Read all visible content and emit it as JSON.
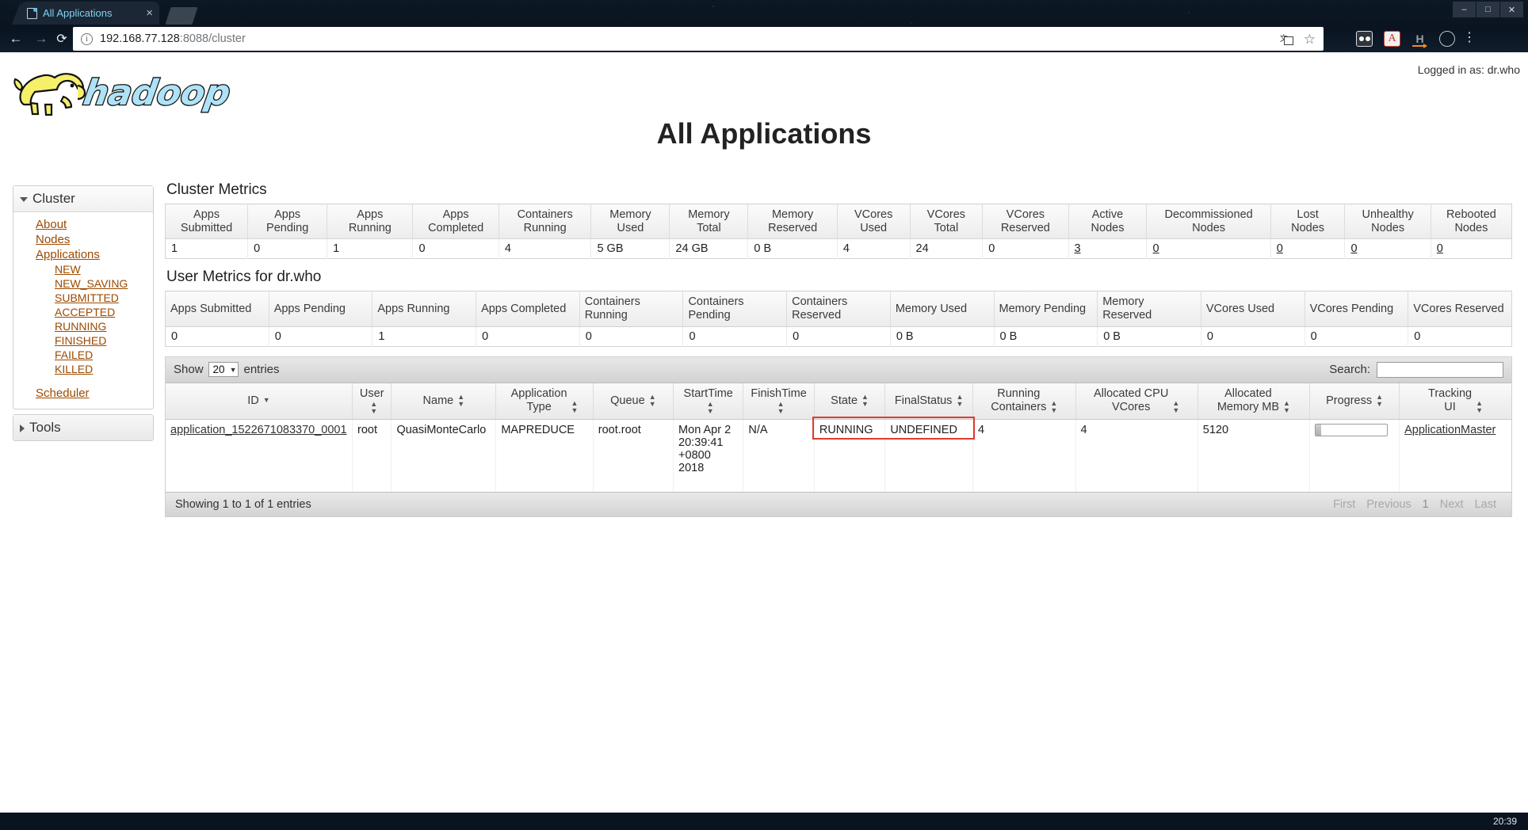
{
  "browser": {
    "tab": {
      "title": "All Applications",
      "favicon": "page-icon",
      "close": "×"
    },
    "nav": {
      "back": "←",
      "forward": "→",
      "reload": "⟳"
    },
    "omnibox": {
      "info_icon": "i",
      "url_host": "192.168.77.128",
      "url_rest": ":8088/cluster",
      "translate_icon": "translate-icon",
      "star_icon": "☆"
    },
    "window_controls": {
      "minimize": "–",
      "maximize": "□",
      "close": "✕",
      "restore": "❐"
    },
    "clock": "20:39"
  },
  "header": {
    "logo_text": "hadoop",
    "logged_in": "Logged in as: dr.who",
    "title": "All Applications"
  },
  "sidebar": {
    "cluster": {
      "label": "Cluster",
      "links": [
        {
          "label": "About"
        },
        {
          "label": "Nodes"
        },
        {
          "label": "Applications"
        }
      ],
      "app_states": [
        {
          "label": "NEW"
        },
        {
          "label": "NEW_SAVING"
        },
        {
          "label": "SUBMITTED"
        },
        {
          "label": "ACCEPTED"
        },
        {
          "label": "RUNNING"
        },
        {
          "label": "FINISHED"
        },
        {
          "label": "FAILED"
        },
        {
          "label": "KILLED"
        }
      ],
      "scheduler": {
        "label": "Scheduler"
      }
    },
    "tools": {
      "label": "Tools"
    }
  },
  "cluster_metrics": {
    "title": "Cluster Metrics",
    "columns": [
      "Apps Submitted",
      "Apps Pending",
      "Apps Running",
      "Apps Completed",
      "Containers Running",
      "Memory Used",
      "Memory Total",
      "Memory Reserved",
      "VCores Used",
      "VCores Total",
      "VCores Reserved",
      "Active Nodes",
      "Decommissioned Nodes",
      "Lost Nodes",
      "Unhealthy Nodes",
      "Rebooted Nodes"
    ],
    "values": [
      "1",
      "0",
      "1",
      "0",
      "4",
      "5 GB",
      "24 GB",
      "0 B",
      "4",
      "24",
      "0",
      "3",
      "0",
      "0",
      "0",
      "0"
    ],
    "linked": [
      false,
      false,
      false,
      false,
      false,
      false,
      false,
      false,
      false,
      false,
      false,
      true,
      true,
      true,
      true,
      true
    ]
  },
  "user_metrics": {
    "title": "User Metrics for dr.who",
    "columns": [
      "Apps Submitted",
      "Apps Pending",
      "Apps Running",
      "Apps Completed",
      "Containers Running",
      "Containers Pending",
      "Containers Reserved",
      "Memory Used",
      "Memory Pending",
      "Memory Reserved",
      "VCores Used",
      "VCores Pending",
      "VCores Reserved"
    ],
    "values": [
      "0",
      "0",
      "1",
      "0",
      "0",
      "0",
      "0",
      "0 B",
      "0 B",
      "0 B",
      "0",
      "0",
      "0"
    ]
  },
  "apps_table": {
    "show_label": "Show",
    "length_value": "20",
    "entries_label": "entries",
    "search_label": "Search:",
    "search_value": "",
    "search_placeholder": "",
    "columns": [
      {
        "label": "ID",
        "sort": "desc"
      },
      {
        "label": "User",
        "sort": "both"
      },
      {
        "label": "Name",
        "sort": "both"
      },
      {
        "label": "Application Type",
        "sort": "both"
      },
      {
        "label": "Queue",
        "sort": "both"
      },
      {
        "label": "StartTime",
        "sort": "both"
      },
      {
        "label": "FinishTime",
        "sort": "both"
      },
      {
        "label": "State",
        "sort": "both"
      },
      {
        "label": "FinalStatus",
        "sort": "both"
      },
      {
        "label": "Running Containers",
        "sort": "both"
      },
      {
        "label": "Allocated CPU VCores",
        "sort": "both"
      },
      {
        "label": "Allocated Memory MB",
        "sort": "both"
      },
      {
        "label": "Progress",
        "sort": "both"
      },
      {
        "label": "Tracking UI",
        "sort": "both"
      }
    ],
    "rows": [
      {
        "id": "application_1522671083370_0001",
        "user": "root",
        "name": "QuasiMonteCarlo",
        "application_type": "MAPREDUCE",
        "queue": "root.root",
        "start_time": "Mon Apr 2 20:39:41 +0800 2018",
        "finish_time": "N/A",
        "state": "RUNNING",
        "final_status": "UNDEFINED",
        "running_containers": "4",
        "allocated_cpu_vcores": "4",
        "allocated_memory_mb": "5120",
        "progress_percent": "0",
        "tracking_ui": "ApplicationMaster"
      }
    ],
    "info": "Showing 1 to 1 of 1 entries",
    "pager": [
      {
        "label": "First"
      },
      {
        "label": "Previous"
      },
      {
        "label": "1"
      },
      {
        "label": "Next"
      },
      {
        "label": "Last"
      }
    ]
  },
  "annotation": {
    "color": "#e03a30",
    "targets": "State, FinalStatus"
  }
}
